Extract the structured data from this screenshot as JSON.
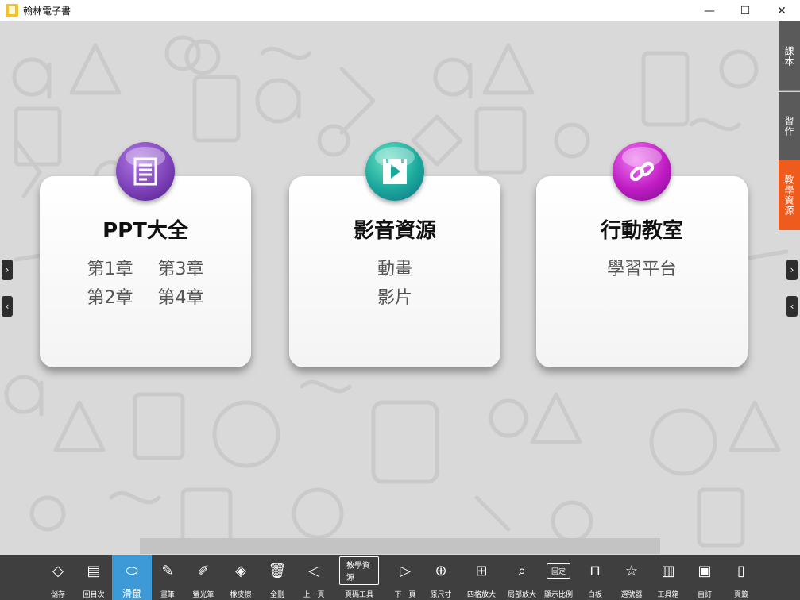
{
  "window": {
    "title": "翰林電子書",
    "minimize": "—",
    "maximize": "☐",
    "close": "✕"
  },
  "cards": [
    {
      "title": "PPT大全",
      "links": [
        [
          "第1章",
          "第3章"
        ],
        [
          "第2章",
          "第4章"
        ]
      ],
      "color": "#7a3fb5"
    },
    {
      "title": "影音資源",
      "links": [
        [
          "動畫"
        ],
        [
          "影片"
        ]
      ],
      "color": "#1ba89b"
    },
    {
      "title": "行動教室",
      "links": [
        [
          "學習平台"
        ]
      ],
      "color": "#c01cc4"
    }
  ],
  "side_tabs": [
    {
      "label": "課本",
      "color": "#5a5a5a"
    },
    {
      "label": "習作",
      "color": "#5a5a5a"
    },
    {
      "label": "教學資源",
      "color": "#ef5b1c"
    }
  ],
  "toolbar": {
    "items": [
      {
        "label": "儲存",
        "icon": "◇"
      },
      {
        "label": "回目次",
        "icon": "▤"
      },
      {
        "label": "滑鼠",
        "icon": "⬭"
      },
      {
        "label": "畫筆",
        "icon": "✎"
      },
      {
        "label": "螢光筆",
        "icon": "✐"
      },
      {
        "label": "橡皮擦",
        "icon": "◈"
      },
      {
        "label": "全刪",
        "icon": "🗑"
      },
      {
        "label": "上一頁",
        "icon": "◁"
      },
      {
        "label": "頁碼工具",
        "icon": "教學資源"
      },
      {
        "label": "下一頁",
        "icon": "▷"
      },
      {
        "label": "原尺寸",
        "icon": "⊕"
      },
      {
        "label": "四格放大",
        "icon": "⊞"
      },
      {
        "label": "局部放大",
        "icon": "⌕"
      },
      {
        "label": "顯示比例",
        "icon": "固定"
      },
      {
        "label": "白板",
        "icon": "⊓"
      },
      {
        "label": "選號器",
        "icon": "☆"
      },
      {
        "label": "工具箱",
        "icon": "▥"
      },
      {
        "label": "自訂",
        "icon": "▣"
      },
      {
        "label": "頁籤",
        "icon": "▯"
      }
    ]
  }
}
